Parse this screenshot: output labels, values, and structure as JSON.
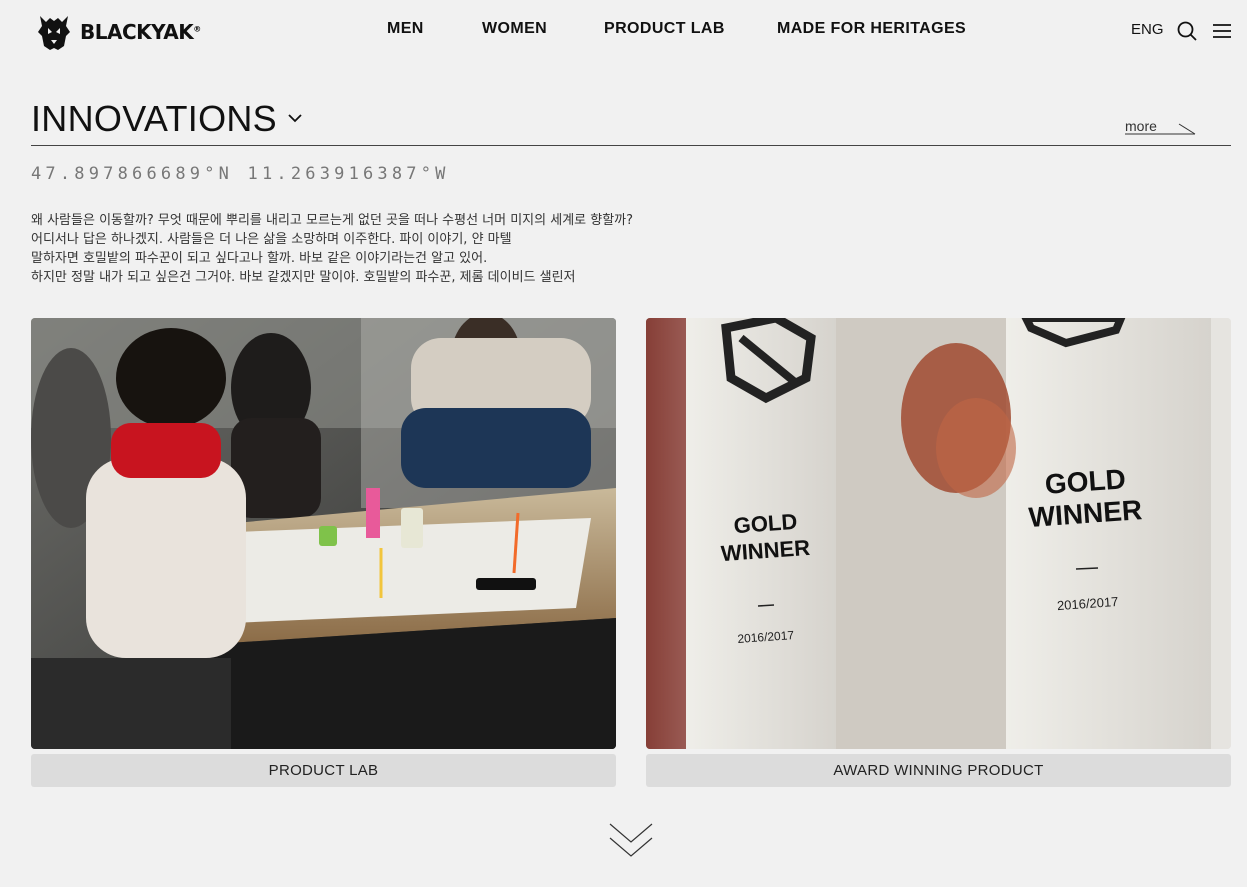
{
  "brand": {
    "name": "BLACKYAK",
    "reg_mark": "®"
  },
  "nav": {
    "items": [
      {
        "label": "MEN"
      },
      {
        "label": "WOMEN"
      },
      {
        "label": "PRODUCT LAB"
      },
      {
        "label": "MADE FOR HERITAGES"
      }
    ]
  },
  "header_tools": {
    "language": "ENG",
    "search_icon": "search-icon",
    "menu_icon": "hamburger-menu-icon"
  },
  "section": {
    "title": "INNOVATIONS",
    "dropdown_icon": "chevron-down-icon",
    "more_label": "more",
    "coordinates": "47.897866689°N 11.263916387°W",
    "description_lines": [
      "왜 사람들은 이동할까? 무엇 때문에 뿌리를 내리고 모르는게 없던 곳을 떠나 수평선 너머 미지의 세계로 향할까?",
      "어디서나 답은 하나겠지. 사람들은 더 나은 삶을 소망하며 이주한다. 파이 이야기, 얀 마텔",
      "말하자면 호밀밭의 파수꾼이 되고 싶다고나 할까. 바보 같은 이야기라는건 알고 있어.",
      "하지만 정말 내가 되고 싶은건 그거야. 바보 같겠지만 말이야. 호밀밭의 파수꾼, 제롬 데이비드 샐린저"
    ]
  },
  "cards": [
    {
      "label": "PRODUCT LAB"
    },
    {
      "label": "AWARD WINNING PRODUCT",
      "award_text_1": "GOLD",
      "award_text_2": "WINNER",
      "award_year": "2016/2017"
    }
  ],
  "colors": {
    "background": "#f1f1f1",
    "text": "#111111",
    "label_bg": "#dcdcdc",
    "coords": "#777777"
  }
}
